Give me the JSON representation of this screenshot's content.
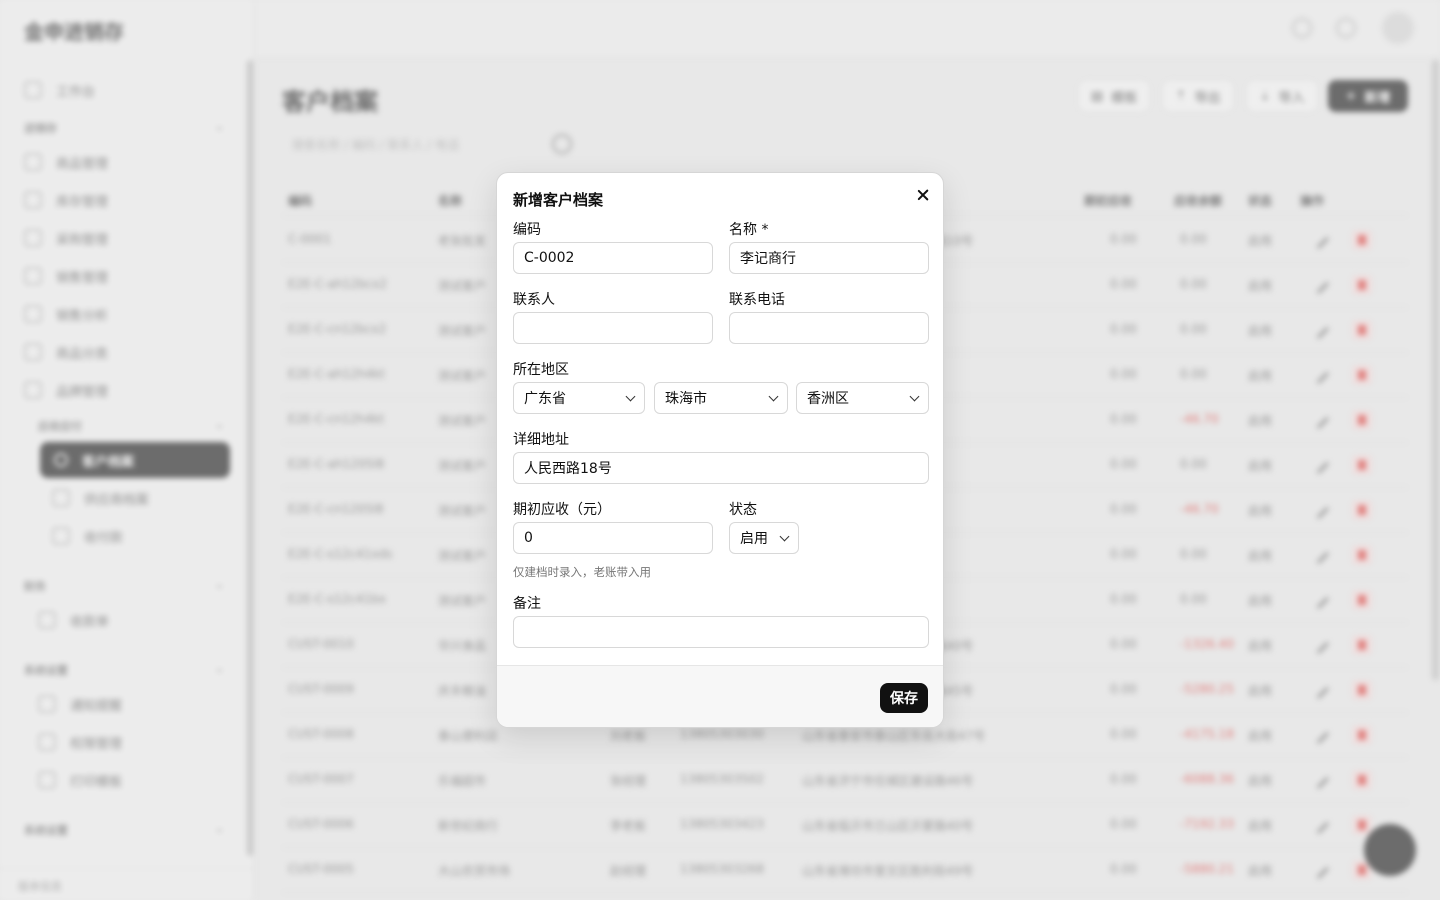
{
  "background": {
    "brand": "金申进销存",
    "page_title": "客户档案",
    "nav": {
      "dashboard": "工作台",
      "groups": [
        "进销存",
        "应收应付",
        "财务",
        "系统设置",
        "系统设置"
      ],
      "items": [
        "商品管理",
        "库存管理",
        "采购管理",
        "销售管理",
        "销售分析",
        "商品分类",
        "品牌管理"
      ],
      "active": "客户档案",
      "sub_items": [
        "供应商档案",
        "收付款"
      ],
      "finance_items": [
        "收款单"
      ],
      "settings_items": [
        "通知提醒",
        "权限管理",
        "打印模板"
      ],
      "footer": "版本信息"
    },
    "toolbar": [
      "模板",
      "导出",
      "导入",
      "新增"
    ],
    "search_placeholder": "搜索名称 / 编码 / 联系人 / 电话",
    "table": {
      "columns": [
        "编码",
        "名称",
        "期初应收",
        "应收余额",
        "状态",
        "操作"
      ],
      "rows": [
        {
          "code": "C-0001",
          "name": "老张批发",
          "contact": "",
          "phone": "",
          "address": "广东省珠海市香洲区人民路10号",
          "opening": "0.00",
          "balance": "0.00",
          "status": "启用",
          "neg": false
        },
        {
          "code": "E2E-C-ah12bcx2",
          "name": "测试客户",
          "contact": "",
          "phone": "",
          "address": "",
          "opening": "0.00",
          "balance": "0.00",
          "status": "启用",
          "neg": false
        },
        {
          "code": "E2E-C-cn12bcx2",
          "name": "测试客户",
          "contact": "",
          "phone": "",
          "address": "",
          "opening": "0.00",
          "balance": "0.00",
          "status": "启用",
          "neg": false
        },
        {
          "code": "E2E-C-ah12h4kt",
          "name": "测试客户",
          "contact": "",
          "phone": "",
          "address": "",
          "opening": "0.00",
          "balance": "0.00",
          "status": "启用",
          "neg": false
        },
        {
          "code": "E2E-C-cn12h4kt",
          "name": "测试客户",
          "contact": "",
          "phone": "",
          "address": "",
          "opening": "0.00",
          "balance": "-46.70",
          "status": "启用",
          "neg": true
        },
        {
          "code": "E2E-C-ah1205l8",
          "name": "测试客户",
          "contact": "",
          "phone": "",
          "address": "",
          "opening": "0.00",
          "balance": "0.00",
          "status": "启用",
          "neg": false
        },
        {
          "code": "E2E-C-cn1205l8",
          "name": "测试客户",
          "contact": "",
          "phone": "",
          "address": "",
          "opening": "0.00",
          "balance": "-46.70",
          "status": "启用",
          "neg": true
        },
        {
          "code": "E2E-C-s12c41xds",
          "name": "测试客户",
          "contact": "",
          "phone": "",
          "address": "",
          "opening": "0.00",
          "balance": "0.00",
          "status": "启用",
          "neg": false
        },
        {
          "code": "E2E-C-s12c41bx",
          "name": "测试客户",
          "contact": "",
          "phone": "",
          "address": "",
          "opening": "0.00",
          "balance": "0.00",
          "status": "启用",
          "neg": false
        },
        {
          "code": "CUST-0010",
          "name": "华兴食品",
          "contact": "",
          "phone": "",
          "address": "山东省济南市历下区经十路40号",
          "opening": "0.00",
          "balance": "-1326.40",
          "status": "启用",
          "neg": true
        },
        {
          "code": "CUST-0009",
          "name": "庆丰粮油",
          "contact": "",
          "phone": "",
          "address": "山东省济南市市中区经七路45号",
          "opening": "0.00",
          "balance": "-5280.25",
          "status": "启用",
          "neg": true
        },
        {
          "code": "CUST-0008",
          "name": "泰山便利店",
          "contact": "刘老板",
          "phone": "13805303030",
          "address": "山东省泰安市泰山区东岳大街47号",
          "opening": "0.00",
          "balance": "-4175.18",
          "status": "启用",
          "neg": true
        },
        {
          "code": "CUST-0007",
          "name": "乐福超市",
          "contact": "张经理",
          "phone": "13805303502",
          "address": "山东省济宁市任城区建设路46号",
          "opening": "0.00",
          "balance": "-6088.36",
          "status": "启用",
          "neg": true
        },
        {
          "code": "CUST-0006",
          "name": "新世纪商行",
          "contact": "李老板",
          "phone": "13805303423",
          "address": "山东省临沂市兰山区沂蒙路40号",
          "opening": "0.00",
          "balance": "-7192.33",
          "status": "启用",
          "neg": true
        },
        {
          "code": "CUST-0005",
          "name": "大山农贸市场",
          "contact": "赵经理",
          "phone": "13805303268",
          "address": "山东省潍坊市奎文区胜利街49号",
          "opening": "0.00",
          "balance": "-5880.21",
          "status": "启用",
          "neg": true
        }
      ]
    }
  },
  "modal": {
    "title": "新增客户档案",
    "fields": {
      "code": {
        "label": "编码",
        "value": "C-0002"
      },
      "name": {
        "label": "名称 *",
        "value": "李记商行"
      },
      "contact": {
        "label": "联系人",
        "value": ""
      },
      "phone": {
        "label": "联系电话",
        "value": ""
      },
      "region": {
        "label": "所在地区",
        "province": "广东省",
        "city": "珠海市",
        "district": "香洲区"
      },
      "address": {
        "label": "详细地址",
        "value": "人民西路18号"
      },
      "opening": {
        "label": "期初应收（元）",
        "value": "0",
        "hint": "仅建档时录入，老账带入用"
      },
      "status": {
        "label": "状态",
        "value": "启用"
      },
      "remark": {
        "label": "备注",
        "value": ""
      }
    },
    "save_label": "保存"
  }
}
